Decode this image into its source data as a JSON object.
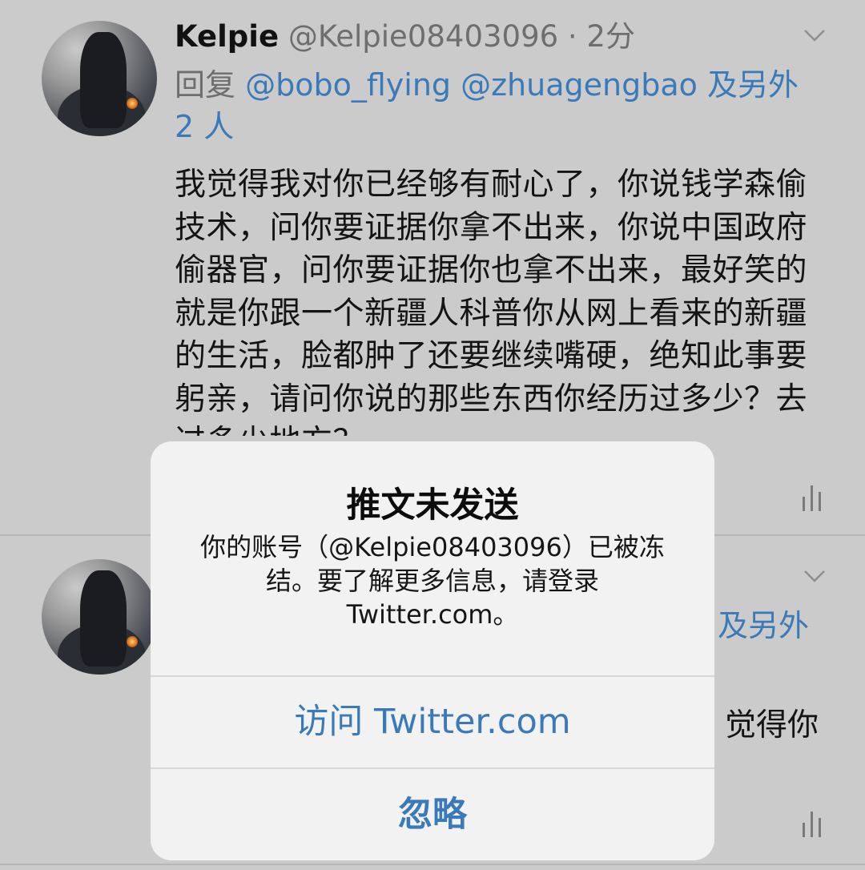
{
  "tweets": [
    {
      "display_name": "Kelpie",
      "handle_time": "@Kelpie08403096 · 2分",
      "reply_prefix": "回复 ",
      "reply_mentions": "@bobo_flying @zhuagengbao 及另外 2 人",
      "body": "我觉得我对你已经够有耐心了，你说钱学森偷技术，问你要证据你拿不出来，你说中国政府偷器官，问你要证据你也拿不出来，最好笑的就是你跟一个新疆人科普你从网上看来的新疆的生活，脸都肿了还要继续嘴硬，绝知此事要躬亲，请问你说的那些东西你经历过多少？去过多少地方？"
    },
    {
      "reply_tail": "及另外",
      "body_tail": "觉得你"
    }
  ],
  "dialog": {
    "title": "推文未发送",
    "message": "你的账号（@Kelpie08403096）已被冻结。要了解更多信息，请登录 Twitter.com。",
    "visit_button": "访问 Twitter.com",
    "ignore_button": "忽略"
  },
  "colors": {
    "link": "#3a7ab8",
    "dimmed_background": "#cbcbcb",
    "dialog_background": "#f2f2f2"
  },
  "icons": [
    "chevron-down-icon",
    "analytics-icon"
  ]
}
